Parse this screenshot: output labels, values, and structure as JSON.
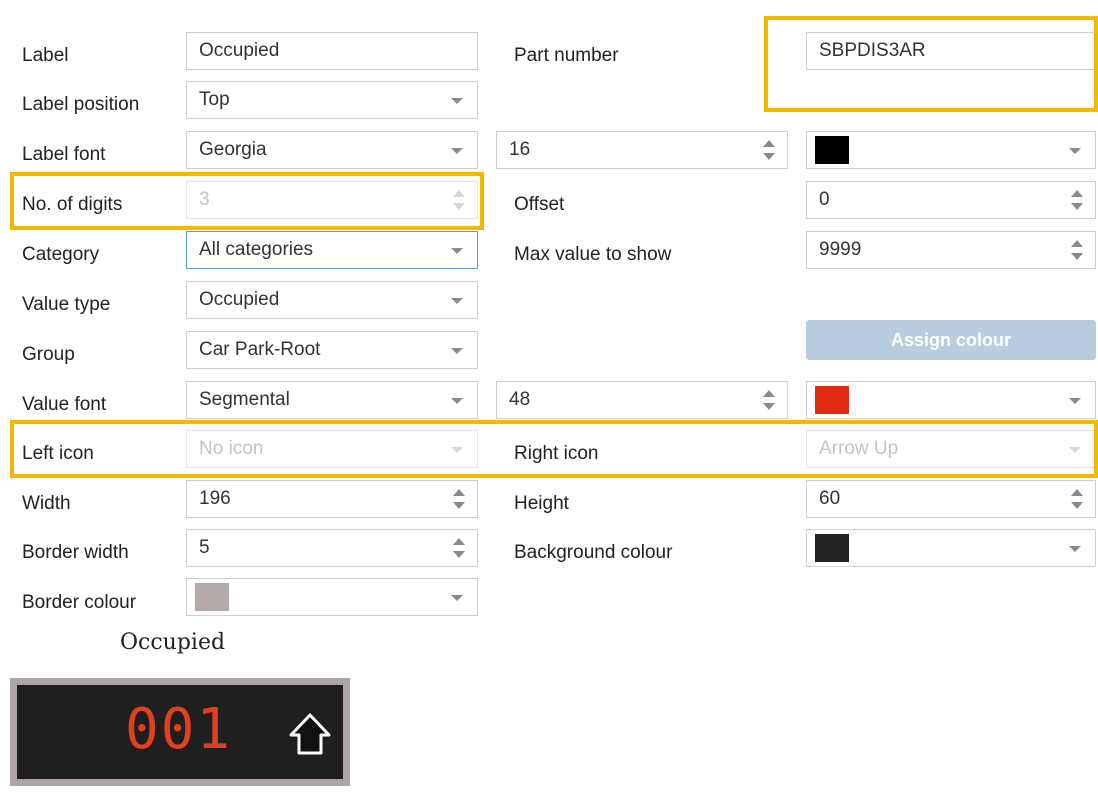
{
  "form": {
    "label": {
      "caption": "Label",
      "value": "Occupied"
    },
    "part_number": {
      "caption": "Part number",
      "value": "SBPDIS3AR"
    },
    "label_position": {
      "caption": "Label position",
      "value": "Top"
    },
    "label_font": {
      "caption": "Label font",
      "font": "Georgia",
      "size": "16",
      "color": "#000000"
    },
    "no_of_digits": {
      "caption": "No. of digits",
      "value": "3"
    },
    "offset": {
      "caption": "Offset",
      "value": "0"
    },
    "category": {
      "caption": "Category",
      "value": "All categories"
    },
    "max_value": {
      "caption": "Max value to show",
      "value": "9999"
    },
    "value_type": {
      "caption": "Value type",
      "value": "Occupied"
    },
    "group": {
      "caption": "Group",
      "value": "Car Park-Root"
    },
    "assign_colour": {
      "label": "Assign colour"
    },
    "value_font": {
      "caption": "Value font",
      "font": "Segmental",
      "size": "48",
      "color": "#e02a10"
    },
    "left_icon": {
      "caption": "Left icon",
      "value": "No icon"
    },
    "right_icon": {
      "caption": "Right icon",
      "value": "Arrow Up"
    },
    "width": {
      "caption": "Width",
      "value": "196"
    },
    "height": {
      "caption": "Height",
      "value": "60"
    },
    "border_width": {
      "caption": "Border width",
      "value": "5"
    },
    "background_colour": {
      "caption": "Background colour",
      "color": "#222222"
    },
    "border_colour": {
      "caption": "Border colour",
      "color": "#b4aaaa"
    }
  },
  "preview": {
    "title": "Occupied",
    "digits": "001",
    "icon": "arrow-up-icon"
  },
  "colors": {
    "highlight": "#f5b800"
  }
}
